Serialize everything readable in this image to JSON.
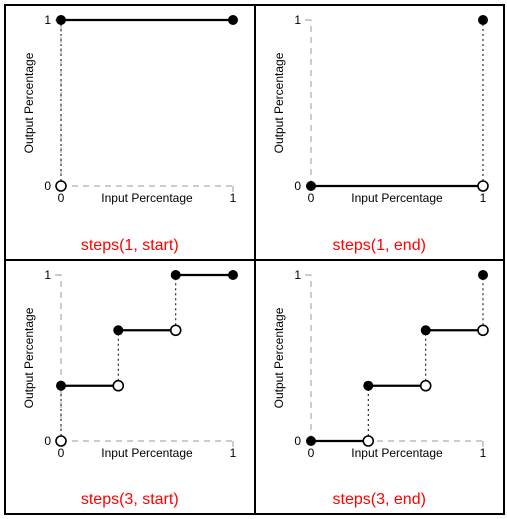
{
  "axes": {
    "xlabel": "Input Percentage",
    "ylabel": "Output Percentage",
    "xticks": [
      "0",
      "1"
    ],
    "yticks": [
      "0",
      "1"
    ]
  },
  "panels": [
    {
      "caption": "steps(1, start)",
      "n": 1,
      "mode": "start"
    },
    {
      "caption": "steps(1, end)",
      "n": 1,
      "mode": "end"
    },
    {
      "caption": "steps(3, start)",
      "n": 3,
      "mode": "start"
    },
    {
      "caption": "steps(3, end)",
      "n": 3,
      "mode": "end"
    }
  ],
  "chart_data": [
    {
      "type": "line",
      "title": "steps(1, start)",
      "xlabel": "Input Percentage",
      "ylabel": "Output Percentage",
      "xlim": [
        0,
        1
      ],
      "ylim": [
        0,
        1
      ],
      "segments": [
        {
          "x0": 0,
          "x1": 1,
          "y": 1
        }
      ],
      "open_points": [
        {
          "x": 0,
          "y": 0
        }
      ],
      "closed_points": [
        {
          "x": 0,
          "y": 1
        },
        {
          "x": 1,
          "y": 1
        }
      ]
    },
    {
      "type": "line",
      "title": "steps(1, end)",
      "xlabel": "Input Percentage",
      "ylabel": "Output Percentage",
      "xlim": [
        0,
        1
      ],
      "ylim": [
        0,
        1
      ],
      "segments": [
        {
          "x0": 0,
          "x1": 1,
          "y": 0
        }
      ],
      "open_points": [
        {
          "x": 1,
          "y": 0
        }
      ],
      "closed_points": [
        {
          "x": 0,
          "y": 0
        },
        {
          "x": 1,
          "y": 1
        }
      ]
    },
    {
      "type": "line",
      "title": "steps(3, start)",
      "xlabel": "Input Percentage",
      "ylabel": "Output Percentage",
      "xlim": [
        0,
        1
      ],
      "ylim": [
        0,
        1
      ],
      "segments": [
        {
          "x0": 0.0,
          "x1": 0.333,
          "y": 0.333
        },
        {
          "x0": 0.333,
          "x1": 0.667,
          "y": 0.667
        },
        {
          "x0": 0.667,
          "x1": 1.0,
          "y": 1.0
        }
      ],
      "open_points": [
        {
          "x": 0.0,
          "y": 0.0
        },
        {
          "x": 0.333,
          "y": 0.333
        },
        {
          "x": 0.667,
          "y": 0.667
        }
      ],
      "closed_points": [
        {
          "x": 0.0,
          "y": 0.333
        },
        {
          "x": 0.333,
          "y": 0.667
        },
        {
          "x": 0.667,
          "y": 1.0
        },
        {
          "x": 1.0,
          "y": 1.0
        }
      ]
    },
    {
      "type": "line",
      "title": "steps(3, end)",
      "xlabel": "Input Percentage",
      "ylabel": "Output Percentage",
      "xlim": [
        0,
        1
      ],
      "ylim": [
        0,
        1
      ],
      "segments": [
        {
          "x0": 0.0,
          "x1": 0.333,
          "y": 0.0
        },
        {
          "x0": 0.333,
          "x1": 0.667,
          "y": 0.333
        },
        {
          "x0": 0.667,
          "x1": 1.0,
          "y": 0.667
        }
      ],
      "open_points": [
        {
          "x": 0.333,
          "y": 0.0
        },
        {
          "x": 0.667,
          "y": 0.333
        },
        {
          "x": 1.0,
          "y": 0.667
        }
      ],
      "closed_points": [
        {
          "x": 0.0,
          "y": 0.0
        },
        {
          "x": 0.333,
          "y": 0.333
        },
        {
          "x": 0.667,
          "y": 0.667
        },
        {
          "x": 1.0,
          "y": 1.0
        }
      ]
    }
  ]
}
